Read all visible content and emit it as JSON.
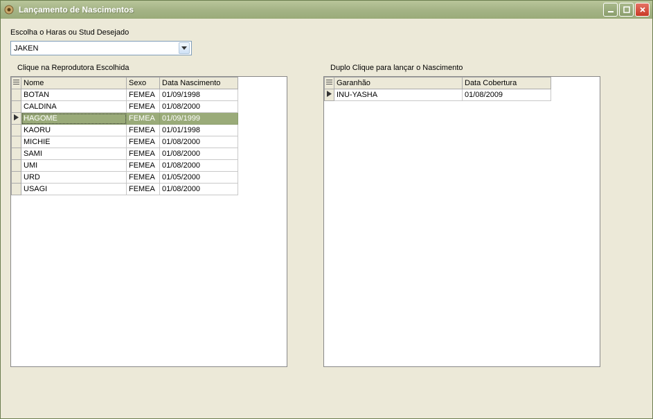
{
  "window": {
    "title": "Lançamento de Nascimentos"
  },
  "prompt1": "Escolha o Haras ou Stud Desejado",
  "combo": {
    "value": "JAKEN"
  },
  "left": {
    "label": "Clique na Reprodutora Escolhida",
    "col_nome": "Nome",
    "col_sexo": "Sexo",
    "col_data": "Data Nascimento",
    "rows": [
      {
        "nome": "BOTAN",
        "sexo": "FEMEA",
        "data": "01/09/1998"
      },
      {
        "nome": "CALDINA",
        "sexo": "FEMEA",
        "data": "01/08/2000"
      },
      {
        "nome": "HAGOME",
        "sexo": "FEMEA",
        "data": "01/09/1999"
      },
      {
        "nome": "KAORU",
        "sexo": "FEMEA",
        "data": "01/01/1998"
      },
      {
        "nome": "MICHIE",
        "sexo": "FEMEA",
        "data": "01/08/2000"
      },
      {
        "nome": "SAMI",
        "sexo": "FEMEA",
        "data": "01/08/2000"
      },
      {
        "nome": "UMI",
        "sexo": "FEMEA",
        "data": "01/08/2000"
      },
      {
        "nome": "URD",
        "sexo": "FEMEA",
        "data": "01/05/2000"
      },
      {
        "nome": "USAGI",
        "sexo": "FEMEA",
        "data": "01/08/2000"
      }
    ],
    "selected_index": 2
  },
  "right": {
    "label": "Duplo Clique para lançar o Nascimento",
    "col_garanhao": "Garanhão",
    "col_data": "Data Cobertura",
    "rows": [
      {
        "garanhao": "INU-YASHA",
        "data": "01/08/2009"
      }
    ],
    "selected_index": 0
  }
}
